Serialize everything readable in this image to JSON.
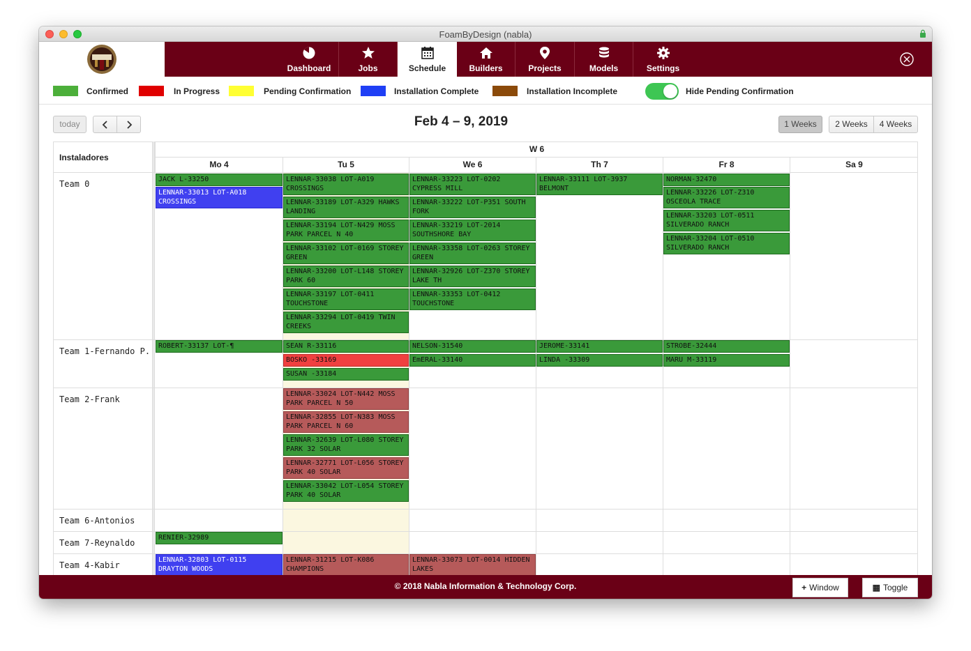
{
  "window": {
    "title": "FoamByDesign (nabla)"
  },
  "nav": {
    "dashboard": {
      "label": "Dashboard",
      "icon": "pie-chart-icon"
    },
    "jobs": {
      "label": "Jobs",
      "icon": "star-icon"
    },
    "schedule": {
      "label": "Schedule",
      "icon": "calendar-icon",
      "active": true
    },
    "builders": {
      "label": "Builders",
      "icon": "home-icon"
    },
    "projects": {
      "label": "Projects",
      "icon": "map-pin-icon"
    },
    "models": {
      "label": "Models",
      "icon": "database-icon"
    },
    "settings": {
      "label": "Settings",
      "icon": "gear-icon"
    },
    "close_icon": "close-circle-icon"
  },
  "legend": {
    "confirmed": {
      "label": "Confirmed",
      "color": "#4caf3a"
    },
    "in_progress": {
      "label": "In Progress",
      "color": "#e00000"
    },
    "pending": {
      "label": "Pending Confirmation",
      "color": "#ffff33"
    },
    "complete": {
      "label": "Installation Complete",
      "color": "#1f3ff5"
    },
    "incomplete": {
      "label": "Installation Incomplete",
      "color": "#8b4a0a"
    },
    "toggle_label": "Hide Pending Confirmation",
    "toggle_on": true
  },
  "toolbar": {
    "today_label": "today",
    "title": "Feb 4 – 9, 2019",
    "view_1": "1 Weeks",
    "view_2": "2 Weeks",
    "view_4": "4 Weeks",
    "active_view": "1 Weeks"
  },
  "calendar": {
    "resource_header": "Instaladores",
    "week_label": "W 6",
    "days": {
      "mo": "Mo 4",
      "tu": "Tu 5",
      "we": "We 6",
      "th": "Th 7",
      "fr": "Fr 8",
      "sa": "Sa 9"
    },
    "teams": {
      "t0": "Team 0",
      "t1": "Team 1-Fernando P.",
      "t2": "Team 2-Frank",
      "t6": "Team 6-Antonios",
      "t7": "Team 7-Reynaldo",
      "t4": "Team 4-Kabir"
    },
    "events": {
      "t0_mo_1": "JACK L-33250",
      "t0_mo_2": "LENNAR-33013 LOT-A018 CROSSINGS",
      "t0_tu_1": "LENNAR-33038 LOT-A019 CROSSINGS",
      "t0_tu_2": "LENNAR-33189 LOT-A329 HAWKS LANDING",
      "t0_tu_3": "LENNAR-33194 LOT-N429 MOSS PARK PARCEL N 40",
      "t0_tu_4": "LENNAR-33102 LOT-0169 STOREY GREEN",
      "t0_tu_5": "LENNAR-33200 LOT-L148 STOREY PARK 60",
      "t0_tu_6": "LENNAR-33197 LOT-0411 TOUCHSTONE",
      "t0_tu_7": "LENNAR-33294 LOT-0419 TWIN CREEKS",
      "t0_we_1": "LENNAR-33223 LOT-0202 CYPRESS MILL",
      "t0_we_2": "LENNAR-33222 LOT-P351 SOUTH FORK",
      "t0_we_3": "LENNAR-33219 LOT-2014 SOUTHSHORE BAY",
      "t0_we_4": "LENNAR-33358 LOT-0263 STOREY GREEN",
      "t0_we_5": "LENNAR-32926 LOT-Z370 STOREY LAKE TH",
      "t0_we_6": "LENNAR-33353 LOT-0412 TOUCHSTONE",
      "t0_th_1": "LENNAR-33111 LOT-3937 BELMONT",
      "t0_fr_1": "NORMAN-32470",
      "t0_fr_2": "LENNAR-33226 LOT-Z310 OSCEOLA TRACE",
      "t0_fr_3": "LENNAR-33203 LOT-0511 SILVERADO RANCH",
      "t0_fr_4": "LENNAR-33204 LOT-0510 SILVERADO RANCH",
      "t1_mo_1": "ROBERT-33137 LOT-¶",
      "t1_tu_1": "SEAN R-33116",
      "t1_tu_2": "BOSKO -33169",
      "t1_tu_3": "SUSAN -33184",
      "t1_we_1": "NELSON-31540",
      "t1_we_2": "EmERAL-33140",
      "t1_th_1": "JEROME-33141",
      "t1_th_2": "LINDA -33309",
      "t1_fr_1": "STROBE-32444",
      "t1_fr_2": "MARU M-33119",
      "t2_tu_1": "LENNAR-33024 LOT-N442 MOSS PARK PARCEL N 50",
      "t2_tu_2": "LENNAR-32855 LOT-N383 MOSS PARK PARCEL N 60",
      "t2_tu_3": "LENNAR-32639 LOT-L080 STOREY PARK 32 SOLAR",
      "t2_tu_4": "LENNAR-32771 LOT-L056 STOREY PARK 40 SOLAR",
      "t2_tu_5": "LENNAR-33042 LOT-L054 STOREY PARK 40 SOLAR",
      "t7_mo_1": "RENIER-32989",
      "t4_mo_1": "LENNAR-32803 LOT-0115 DRAYTON WOODS",
      "t4_tu_1": "LENNAR-31215 LOT-K086 CHAMPIONS",
      "t4_we_1": "LENNAR-33073 LOT-0014 HIDDEN LAKES"
    }
  },
  "footer": {
    "copyright": "© 2018 Nabla Information & Technology Corp.",
    "window_button": "Window",
    "toggle_button": "Toggle"
  }
}
